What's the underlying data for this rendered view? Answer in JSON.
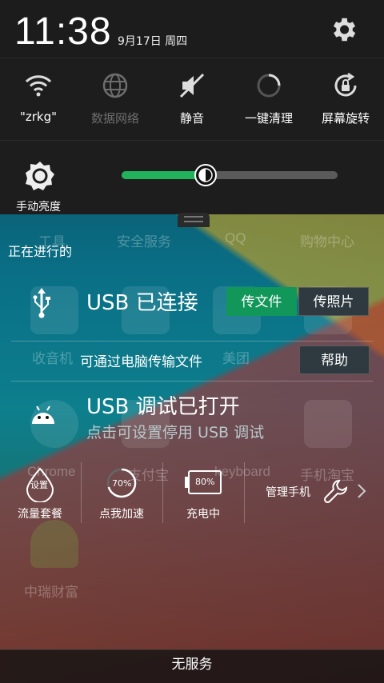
{
  "header": {
    "time": "11:38",
    "date": "9月17日 周四"
  },
  "toggles": [
    {
      "label": "\"zrkg\"",
      "icon": "wifi-icon",
      "active": true
    },
    {
      "label": "数据网络",
      "icon": "globe-icon",
      "active": false
    },
    {
      "label": "静音",
      "icon": "mute-icon",
      "active": true
    },
    {
      "label": "一键清理",
      "icon": "clean-icon",
      "active": true
    },
    {
      "label": "屏幕旋转",
      "icon": "rotate-lock-icon",
      "active": true
    }
  ],
  "brightness": {
    "label": "手动亮度",
    "level": 0.39,
    "accent": "#21b35c"
  },
  "notifications": {
    "section_title": "正在进行的",
    "usb": {
      "title": "USB 已连接",
      "btn_file": "传文件",
      "btn_photo": "传照片",
      "desc": "可通过电脑传输文件",
      "btn_help": "帮助"
    },
    "debug": {
      "title": "USB 调试已打开",
      "subtitle": "点击可设置停用 USB 调试"
    }
  },
  "shortcuts": [
    {
      "badge": "设置",
      "label": "流量套餐"
    },
    {
      "badge": "70%",
      "label": "点我加速"
    },
    {
      "badge": "80%",
      "label": "充电中"
    },
    {
      "label": "管理手机"
    }
  ],
  "background_apps": {
    "row1": [
      "工具",
      "安全服务",
      "QQ",
      "购物中心"
    ],
    "row2": [
      "收音机",
      "美团"
    ],
    "row3": [
      "Chrome",
      "支付宝",
      "keyboard",
      "手机淘宝"
    ],
    "row4": [
      "中瑞财富"
    ]
  },
  "footer": {
    "service": "无服务"
  }
}
